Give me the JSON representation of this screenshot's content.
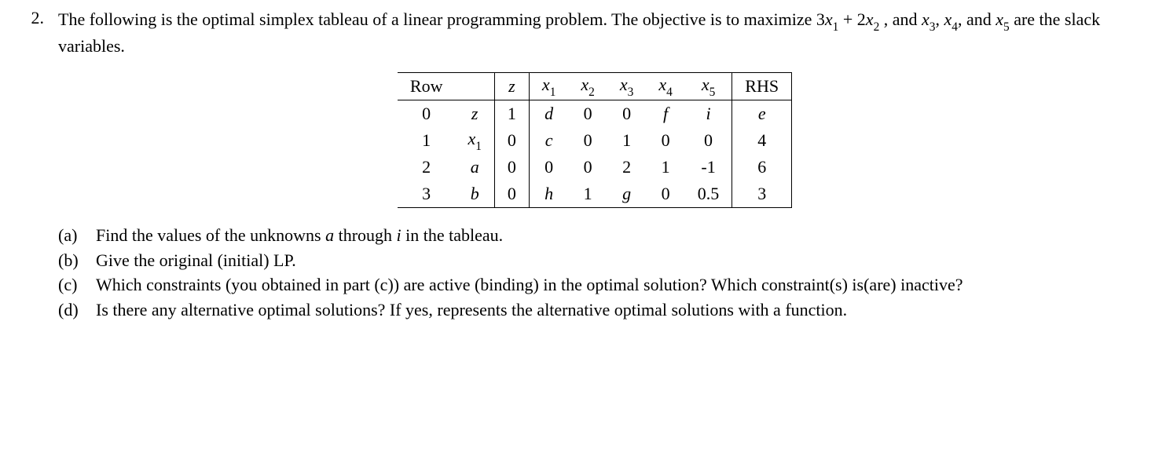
{
  "problem": {
    "number": "2.",
    "intro_partial_line": "",
    "intro": "The following is the optimal simplex tableau of a linear programming problem. The objective is to maximize 3x₁ + 2x₂ , and x₃, x₄, and x₅ are the slack variables."
  },
  "table": {
    "headers": {
      "row": "Row",
      "blank": "",
      "z": "z",
      "x1": "x1",
      "x2": "x2",
      "x3": "x3",
      "x4": "x4",
      "x5": "x5",
      "rhs": "RHS"
    },
    "rows": [
      {
        "rownum": "0",
        "basic": "z",
        "z": "1",
        "x1": "d",
        "x2": "0",
        "x3": "0",
        "x4": "f",
        "x5": "i",
        "rhs": "e"
      },
      {
        "rownum": "1",
        "basic": "x1",
        "z": "0",
        "x1": "c",
        "x2": "0",
        "x3": "1",
        "x4": "0",
        "x5": "0",
        "rhs": "4"
      },
      {
        "rownum": "2",
        "basic": "a",
        "z": "0",
        "x1": "0",
        "x2": "0",
        "x3": "2",
        "x4": "1",
        "x5": "-1",
        "rhs": "6"
      },
      {
        "rownum": "3",
        "basic": "b",
        "z": "0",
        "x1": "h",
        "x2": "1",
        "x3": "g",
        "x4": "0",
        "x5": "0.5",
        "rhs": "3"
      }
    ]
  },
  "subparts": {
    "a": {
      "label": "(a)",
      "text": "Find the values of the unknowns a through i in the tableau."
    },
    "b": {
      "label": "(b)",
      "text": "Give the original (initial) LP."
    },
    "c": {
      "label": "(c)",
      "text": "Which constraints (you obtained in part (c)) are active (binding) in the optimal solution? Which constraint(s) is(are) inactive?"
    },
    "d": {
      "label": "(d)",
      "text": "Is there any alternative optimal solutions? If yes, represents the alternative optimal solutions with a function."
    }
  }
}
